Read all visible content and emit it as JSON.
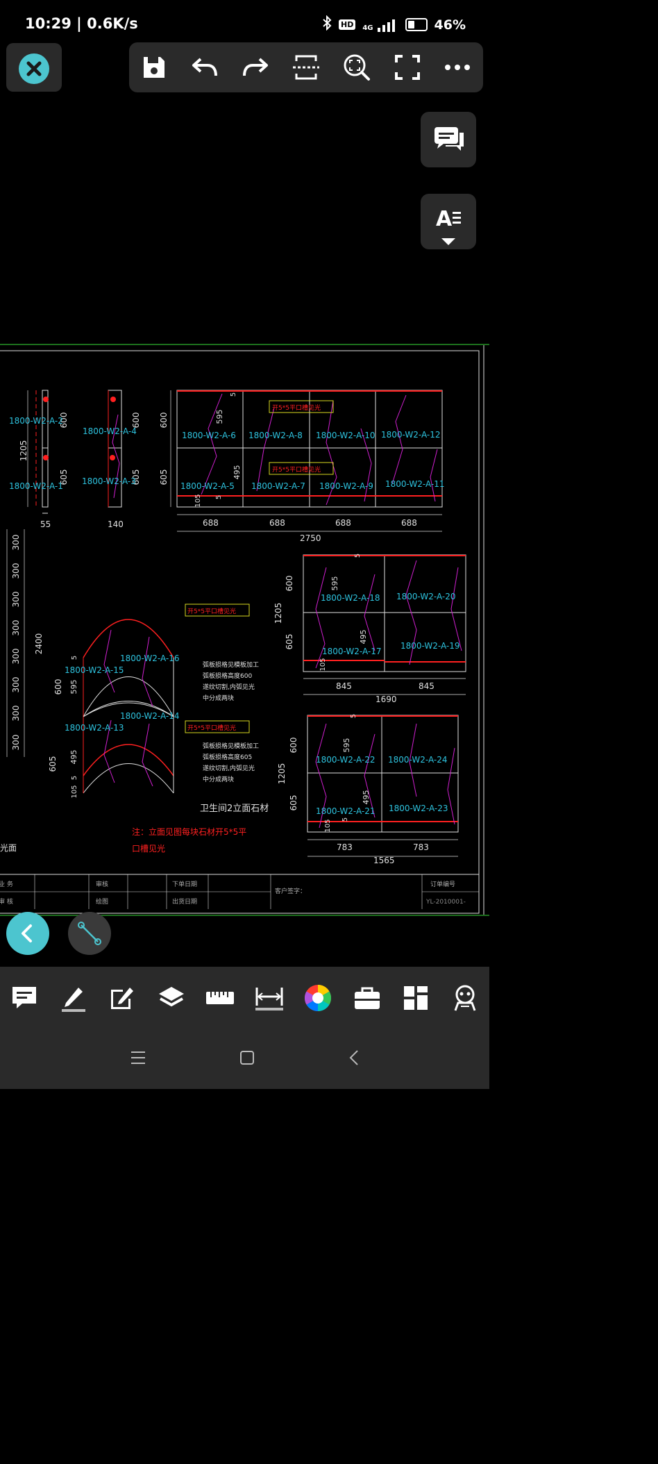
{
  "status": {
    "time_speed": "10:29 | 0.6K/s",
    "net_label": "4G",
    "hd_label": "HD",
    "battery": "46%",
    "battery_level": 0.46
  },
  "toolbar": {
    "icons": [
      "save-icon",
      "undo-icon",
      "redo-icon",
      "crop-icon",
      "zoom-fit-icon",
      "fullscreen-icon",
      "more-icon"
    ]
  },
  "drawing": {
    "dims_top": [
      "688",
      "688",
      "688",
      "688"
    ],
    "dim_total_top": "2750",
    "dims_left": [
      "600",
      "605"
    ],
    "dim_1205": "1205",
    "dim_55": "55",
    "dim_140": "140",
    "dim_595": "595",
    "dim_495": "495",
    "dim_105": "105",
    "dim_5": "5",
    "dim_2400": "2400",
    "dim_300": "300",
    "dims_mid": [
      "845",
      "845"
    ],
    "dim_total_mid": "1690",
    "dims_low": [
      "783",
      "783"
    ],
    "dim_total_low": "1565",
    "labels": {
      "a1": "1800-W2-A-1",
      "a2": "1800-W2-A-2",
      "a3": "1800-W2-A-3",
      "a4": "1800-W2-A-4",
      "a5": "1800-W2-A-5",
      "a6": "1800-W2-A-6",
      "a7": "1800-W2-A-7",
      "a8": "1800-W2-A-8",
      "a9": "1800-W2-A-9",
      "a10": "1800-W2-A-10",
      "a11": "1800-W2-A-11",
      "a12": "1800-W2-A-12",
      "a13": "1800-W2-A-13",
      "a14": "1800-W2-A-14",
      "a15": "1800-W2-A-15",
      "a16": "1800-W2-A-16",
      "a17": "1800-W2-A-17",
      "a18": "1800-W2-A-18",
      "a19": "1800-W2-A-19",
      "a20": "1800-W2-A-20",
      "a21": "1800-W2-A-21",
      "a22": "1800-W2-A-22",
      "a23": "1800-W2-A-23",
      "a24": "1800-W2-A-24"
    },
    "slot_note": "开5*5平口槽见光",
    "arc_notes": [
      "弧板损格见模板加工",
      "弧板损格高度600",
      "遂纹切割,内弧见光",
      "中分成两块"
    ],
    "arc_notes2": [
      "弧板损格见模板加工",
      "弧板损格高度605",
      "遂纹切割,内弧见光",
      "中分成两块"
    ],
    "title": "卫生间2立面石材",
    "note_red_1": "注：立面见图每块石材开5*5平",
    "note_red_2": "口槽见光",
    "left_cut_text": "光面"
  },
  "titleblock": {
    "r1c1": "业 务",
    "r2c1": "审 核",
    "r1c2": "审核",
    "r2c2": "绘图",
    "r1c3": "下单日期",
    "r2c3": "出货日期",
    "customer_sign": "客户签字：",
    "order_no_label": "订单编号",
    "order_no": "YL-2010001-"
  },
  "colors": {
    "accent": "#4cc5cf",
    "cad_cyan": "#2ec4e0",
    "cad_red": "#ff2020",
    "cad_magenta": "#d020d0",
    "cad_yellow": "#d8d820",
    "cad_white": "#e0e0e0",
    "panel_bg": "#2a2a2a"
  },
  "bottom_tools": [
    "comment-icon",
    "pen-icon",
    "edit-icon",
    "layers-icon",
    "ruler-icon",
    "dimension-icon",
    "color-wheel-icon",
    "toolbox-icon",
    "apps-icon",
    "robot-icon"
  ],
  "nav": [
    "menu-icon",
    "home-icon",
    "back-icon"
  ]
}
